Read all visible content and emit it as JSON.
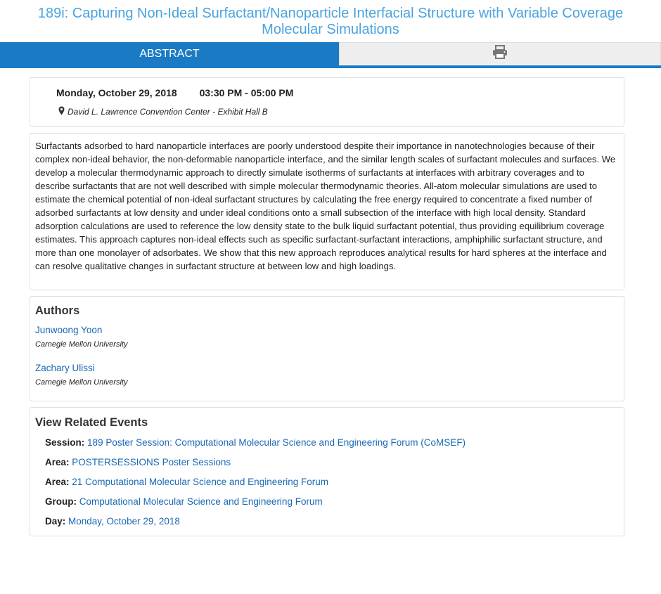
{
  "title": "189i: Capturing Non-Ideal Surfactant/Nanoparticle Interfacial Structure with Variable Coverage Molecular Simulations",
  "tabs": {
    "abstract_label": "ABSTRACT",
    "print_icon": "printer-icon"
  },
  "event": {
    "date": "Monday, October 29, 2018",
    "time": "03:30 PM - 05:00 PM",
    "location": "David L. Lawrence Convention Center - Exhibit Hall B",
    "location_icon": "map-marker-icon"
  },
  "abstract": "Surfactants adsorbed to hard nanoparticle interfaces are poorly understood despite their importance in nanotechnologies because of their complex non-ideal behavior, the non-deformable nanoparticle interface, and the similar length scales of surfactant molecules and surfaces. We develop a molecular thermodynamic approach to directly simulate isotherms of surfactants at interfaces with arbitrary coverages and to describe surfactants that are not well described with simple molecular thermodynamic theories. All-atom molecular simulations are used to estimate the chemical potential of non-ideal surfactant structures by calculating the free energy required to concentrate a fixed number of adsorbed surfactants at low density and under ideal conditions onto a small subsection of the interface with high local density. Standard adsorption calculations are used to reference the low density state to the bulk liquid surfactant potential, thus providing equilibrium coverage estimates. This approach captures non-ideal effects such as specific surfactant-surfactant interactions, amphiphilic surfactant structure, and more than one monolayer of adsorbates. We show that this new approach reproduces analytical results for hard spheres at the interface and can resolve qualitative changes in surfactant structure at between low and high loadings.",
  "authors": {
    "heading": "Authors",
    "list": [
      {
        "name": "Junwoong Yoon",
        "affiliation": "Carnegie Mellon University"
      },
      {
        "name": "Zachary Ulissi",
        "affiliation": "Carnegie Mellon University"
      }
    ]
  },
  "related": {
    "heading": "View Related Events",
    "items": [
      {
        "label": "Session:",
        "value": "189 Poster Session: Computational Molecular Science and Engineering Forum (CoMSEF)"
      },
      {
        "label": "Area:",
        "value": "POSTERSESSIONS Poster Sessions"
      },
      {
        "label": "Area:",
        "value": "21 Computational Molecular Science and Engineering Forum"
      },
      {
        "label": "Group:",
        "value": "Computational Molecular Science and Engineering Forum"
      },
      {
        "label": "Day:",
        "value": "Monday, October 29, 2018"
      }
    ]
  },
  "colors": {
    "accent": "#1a7bc4",
    "title": "#4aa3df",
    "link": "#1a68b5"
  }
}
